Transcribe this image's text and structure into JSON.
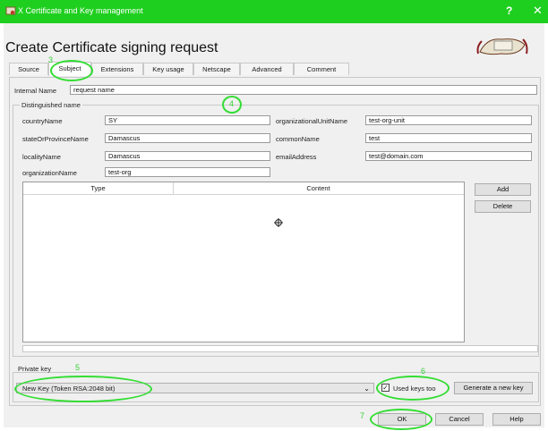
{
  "window": {
    "title": "X Certificate and Key management",
    "help_glyph": "?",
    "close_glyph": "✕"
  },
  "heading": "Create Certificate signing request",
  "tabs": [
    {
      "label": "Source"
    },
    {
      "label": "Subject"
    },
    {
      "label": "Extensions"
    },
    {
      "label": "Key usage"
    },
    {
      "label": "Netscape"
    },
    {
      "label": "Advanced"
    },
    {
      "label": "Comment"
    }
  ],
  "internal_name": {
    "label": "Internal Name",
    "value": "request name"
  },
  "distinguished": {
    "label": "Distinguished name",
    "fields": [
      {
        "label": "countryName",
        "value": "SY"
      },
      {
        "label": "stateOrProvinceName",
        "value": "Damascus"
      },
      {
        "label": "localityName",
        "value": "Damascus"
      },
      {
        "label": "organizationName",
        "value": "test-org"
      },
      {
        "label": "organizationalUnitName",
        "value": "test-org-unit"
      },
      {
        "label": "commonName",
        "value": "test"
      },
      {
        "label": "emailAddress",
        "value": "test@domain.com"
      }
    ]
  },
  "table": {
    "columns": [
      "Type",
      "Content"
    ],
    "add_label": "Add",
    "delete_label": "Delete"
  },
  "private_key": {
    "label": "Private key",
    "selected": "New Key (Token RSA:2048 bit)",
    "used_keys_label": "Used keys too",
    "generate_label": "Generate a new key"
  },
  "footer": {
    "ok_label": "OK",
    "cancel_label": "Cancel",
    "help_label": "Help"
  },
  "annotations": {
    "n3": "3",
    "n4": "4",
    "n5": "5",
    "n6": "6",
    "n7": "7"
  },
  "colors": {
    "titlebar": "#1fcf1f",
    "annotation": "#33dd33"
  }
}
